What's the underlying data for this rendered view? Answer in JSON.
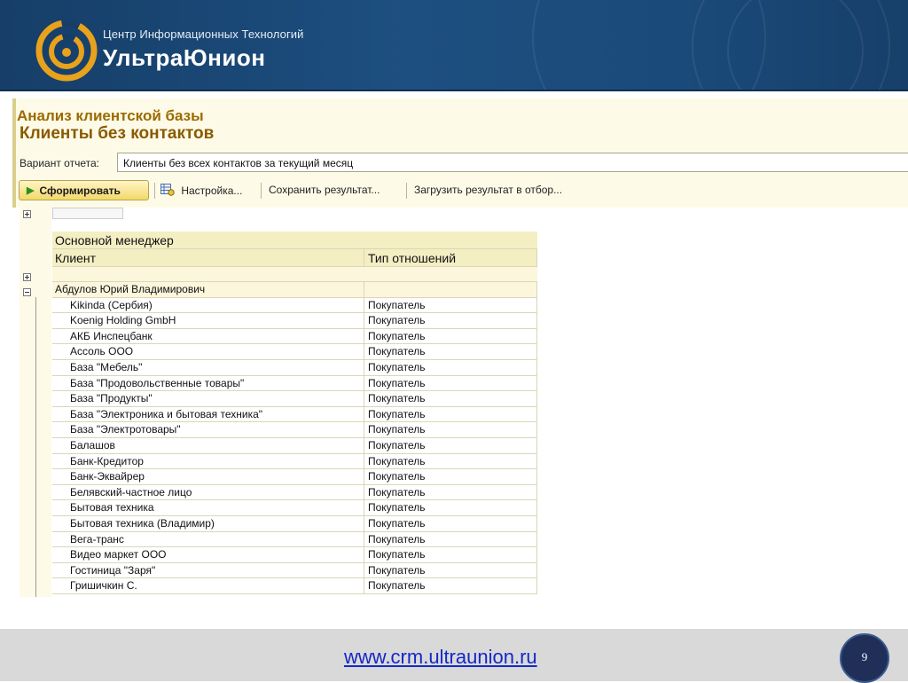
{
  "header": {
    "brand_sub": "Центр Информационных Технологий",
    "brand_main": "УльтраЮнион",
    "colors": {
      "bg": "#1d4f80",
      "logo_gold": "#e8a21c"
    }
  },
  "report": {
    "breadcrumb": "Анализ клиентской базы",
    "title": "Клиенты без контактов",
    "variant_label": "Вариант отчета:",
    "variant_value": "Клиенты без всех контактов за текущий месяц",
    "toolbar": {
      "form_label": "Сформировать",
      "settings_label": "Настройка...",
      "save_label": "Сохранить результат...",
      "load_label": "Загрузить результат в отбор..."
    },
    "columns": {
      "manager": "Основной менеджер",
      "client": "Клиент",
      "relation": "Тип отношений"
    },
    "group_name": "Абдулов Юрий Владимирович",
    "rows": [
      {
        "client": "Kikinda (Сербия)",
        "relation": "Покупатель"
      },
      {
        "client": "Koenig Holding GmbH",
        "relation": "Покупатель"
      },
      {
        "client": "АКБ Инспецбанк",
        "relation": "Покупатель"
      },
      {
        "client": "Ассоль ООО",
        "relation": "Покупатель"
      },
      {
        "client": "База \"Мебель\"",
        "relation": "Покупатель"
      },
      {
        "client": "База \"Продовольственные товары\"",
        "relation": "Покупатель"
      },
      {
        "client": "База \"Продукты\"",
        "relation": "Покупатель"
      },
      {
        "client": "База \"Электроника и бытовая техника\"",
        "relation": "Покупатель"
      },
      {
        "client": "База \"Электротовары\"",
        "relation": "Покупатель"
      },
      {
        "client": "Балашов",
        "relation": "Покупатель"
      },
      {
        "client": "Банк-Кредитор",
        "relation": "Покупатель"
      },
      {
        "client": "Банк-Эквайрер",
        "relation": "Покупатель"
      },
      {
        "client": "Белявский-частное лицо",
        "relation": "Покупатель"
      },
      {
        "client": "Бытовая техника",
        "relation": "Покупатель"
      },
      {
        "client": "Бытовая техника (Владимир)",
        "relation": "Покупатель"
      },
      {
        "client": "Вега-транс",
        "relation": "Покупатель"
      },
      {
        "client": "Видео маркет ООО",
        "relation": "Покупатель"
      },
      {
        "client": "Гостиница \"Заря\"",
        "relation": "Покупатель"
      },
      {
        "client": "Гришичкин С.",
        "relation": "Покупатель"
      }
    ]
  },
  "footer": {
    "url": "www.crm.ultraunion.ru",
    "page_number": "9"
  }
}
